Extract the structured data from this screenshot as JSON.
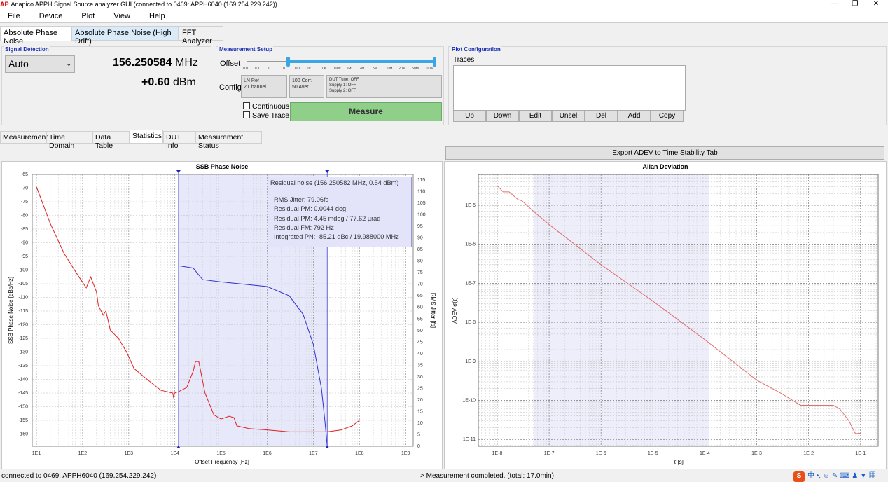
{
  "window": {
    "logo": "AP",
    "title": "Anapico APPH Signal Source analyzer GUI (connected to 0469: APPH6040 (169.254.229.242))"
  },
  "menu": [
    "File",
    "Device",
    "Plot",
    "View",
    "Help"
  ],
  "main_tabs": [
    "Absolute Phase Noise",
    "Absolute Phase Noise (High Drift)",
    "FFT Analyzer"
  ],
  "signal_detection": {
    "title": "Signal Detection",
    "mode": "Auto",
    "frequency_value": "156.250584",
    "frequency_unit": "MHz",
    "power_value": "+0.60",
    "power_unit": "dBm"
  },
  "measurement_setup": {
    "title": "Measurement Setup",
    "offset_label": "Offset",
    "offset_ticks": [
      "0.01",
      "0.1",
      "1",
      "10",
      "100",
      "1k",
      "10k",
      "100k",
      "1M",
      "2M",
      "5M",
      "10M",
      "20M",
      "50M",
      "100M"
    ],
    "offset_range": [
      "10",
      "100M"
    ],
    "config_label": "Config",
    "config_buttons": [
      [
        "LN Ref",
        "2 Channel"
      ],
      [
        "100 Corr.",
        "50 Aver."
      ],
      [
        "DUT Tune: OFF",
        "Supply 1: OFF",
        "Supply 2: OFF"
      ]
    ],
    "continuous": "Continuous",
    "save_trace": "Save Trace",
    "measure": "Measure",
    "measure_color": "#8fcf8a"
  },
  "plot_config": {
    "title": "Plot Configuration",
    "traces_label": "Traces",
    "buttons": [
      "Up",
      "Down",
      "Edit",
      "Unsel",
      "Del",
      "Add",
      "Copy"
    ]
  },
  "sub_tabs": [
    "Measurement",
    "Time Domain",
    "Data Table",
    "Statistics",
    "DUT Info",
    "Measurement Status"
  ],
  "export_button": "Export ADEV to Time Stability Tab",
  "status": {
    "left": "connected to 0469: APPH6040 (169.254.229.242)",
    "right": "> Measurement completed. (total: 17.0min)"
  },
  "chart_data": [
    {
      "type": "line",
      "title": "SSB Phase Noise",
      "xlabel": "Offset Frequency [Hz]",
      "ylabel": "SSB Phase Noise [dBc/Hz]",
      "y2label": "RMS Jitter [fs]",
      "xscale": "log",
      "xlim": [
        10,
        1000000000.0
      ],
      "ylim": [
        -164.6,
        -65
      ],
      "y2lim": [
        0,
        115
      ],
      "xticks": [
        "1E1",
        "1E2",
        "1E3",
        "1E4",
        "1E5",
        "1E6",
        "1E7",
        "1E8",
        "1E9"
      ],
      "yticks": [
        -65,
        -70,
        -75,
        -80,
        -85,
        -90,
        -95,
        -100,
        -105,
        -110,
        -115,
        -120,
        -125,
        -130,
        -135,
        -140,
        -145,
        -150,
        -155,
        -160
      ],
      "y2ticks": [
        115,
        110,
        105,
        100,
        95,
        90,
        85,
        80,
        75,
        70,
        65,
        60,
        55,
        50,
        45,
        40,
        35,
        30,
        25,
        20,
        15,
        10,
        5,
        0
      ],
      "integration_range": [
        12000,
        20000000
      ],
      "grid": true,
      "series": [
        {
          "axis": "left",
          "color": "#e02020",
          "points": [
            [
              10,
              -69.5
            ],
            [
              20,
              -83
            ],
            [
              40,
              -94
            ],
            [
              70,
              -100.5
            ],
            [
              100,
              -104.5
            ],
            [
              120,
              -106.5
            ],
            [
              150,
              -102.5
            ],
            [
              200,
              -108
            ],
            [
              220,
              -113
            ],
            [
              280,
              -116.5
            ],
            [
              320,
              -115
            ],
            [
              400,
              -122
            ],
            [
              600,
              -125
            ],
            [
              900,
              -130
            ],
            [
              1300,
              -136
            ],
            [
              2500,
              -140
            ],
            [
              5000,
              -144
            ],
            [
              9000,
              -145
            ],
            [
              9500,
              -147
            ],
            [
              9800,
              -145
            ],
            [
              12000,
              -144.5
            ],
            [
              18000,
              -143
            ],
            [
              25000,
              -137
            ],
            [
              28000,
              -133.5
            ],
            [
              33000,
              -133.5
            ],
            [
              45000,
              -145
            ],
            [
              70000,
              -153
            ],
            [
              100000,
              -154.5
            ],
            [
              150000,
              -153.5
            ],
            [
              190000,
              -154
            ],
            [
              220000,
              -157
            ],
            [
              400000,
              -158
            ],
            [
              1000000,
              -158.5
            ],
            [
              3000000,
              -159.2
            ],
            [
              20000000,
              -159.2
            ],
            [
              40000000,
              -158.5
            ],
            [
              70000000,
              -157
            ],
            [
              100000000,
              -155
            ]
          ]
        },
        {
          "axis": "right",
          "color": "#3030d0",
          "points": [
            [
              12000,
              78
            ],
            [
              25000,
              77
            ],
            [
              30000,
              75
            ],
            [
              40000,
              72
            ],
            [
              100000,
              71
            ],
            [
              1000000,
              69
            ],
            [
              3000000,
              65
            ],
            [
              6000000,
              57
            ],
            [
              10000000,
              44
            ],
            [
              15000000,
              25
            ],
            [
              18000000,
              10
            ],
            [
              20000000,
              0
            ]
          ]
        }
      ],
      "annotation": {
        "header": "Residual noise (156.250582 MHz, 0.54 dBm)",
        "lines": [
          "RMS Jitter: 79.06fs",
          "Residual PM: 0.0044 deg",
          "Residual PM: 4.45 mdeg / 77.62 µrad",
          "Residual FM: 792 Hz",
          "Integrated PN: -85.21 dBc / 19.988000 MHz"
        ]
      }
    },
    {
      "type": "line",
      "title": "Allan Deviation",
      "xlabel": "τ [s]",
      "ylabel": "ADEV σ(τ)",
      "xscale": "log",
      "yscale": "log",
      "xlim": [
        4.4e-09,
        0.22
      ],
      "ylim": [
        5.2e-12,
        6e-05
      ],
      "xticks": [
        "1E-8",
        "1E-7",
        "1E-6",
        "1E-5",
        "1E-4",
        "1E-3",
        "1E-2",
        "1E-1"
      ],
      "yticks": [
        "1E-5",
        "1E-6",
        "1E-7",
        "1E-8",
        "1E-9",
        "1E-10",
        "1E-11"
      ],
      "highlight_range": [
        5e-08,
        0.00012
      ],
      "grid": true,
      "series": [
        {
          "color": "#e07070",
          "points": [
            [
              1e-08,
              3.2e-05
            ],
            [
              1.3e-08,
              2.2e-05
            ],
            [
              1.7e-08,
              2.2e-05
            ],
            [
              2.5e-08,
              1.4e-05
            ],
            [
              3e-08,
              1.3e-05
            ],
            [
              5e-08,
              7e-06
            ],
            [
              1e-07,
              3.2e-06
            ],
            [
              1e-06,
              3e-07
            ],
            [
              1e-05,
              3.5e-08
            ],
            [
              0.0001,
              3.6e-09
            ],
            [
              0.001,
              3.3e-10
            ],
            [
              0.003,
              1.5e-10
            ],
            [
              0.007,
              7.5e-11
            ],
            [
              0.03,
              7.5e-11
            ],
            [
              0.04,
              6e-11
            ],
            [
              0.06,
              3e-11
            ],
            [
              0.08,
              1.4e-11
            ],
            [
              0.1,
              1.45e-11
            ]
          ]
        }
      ]
    }
  ]
}
